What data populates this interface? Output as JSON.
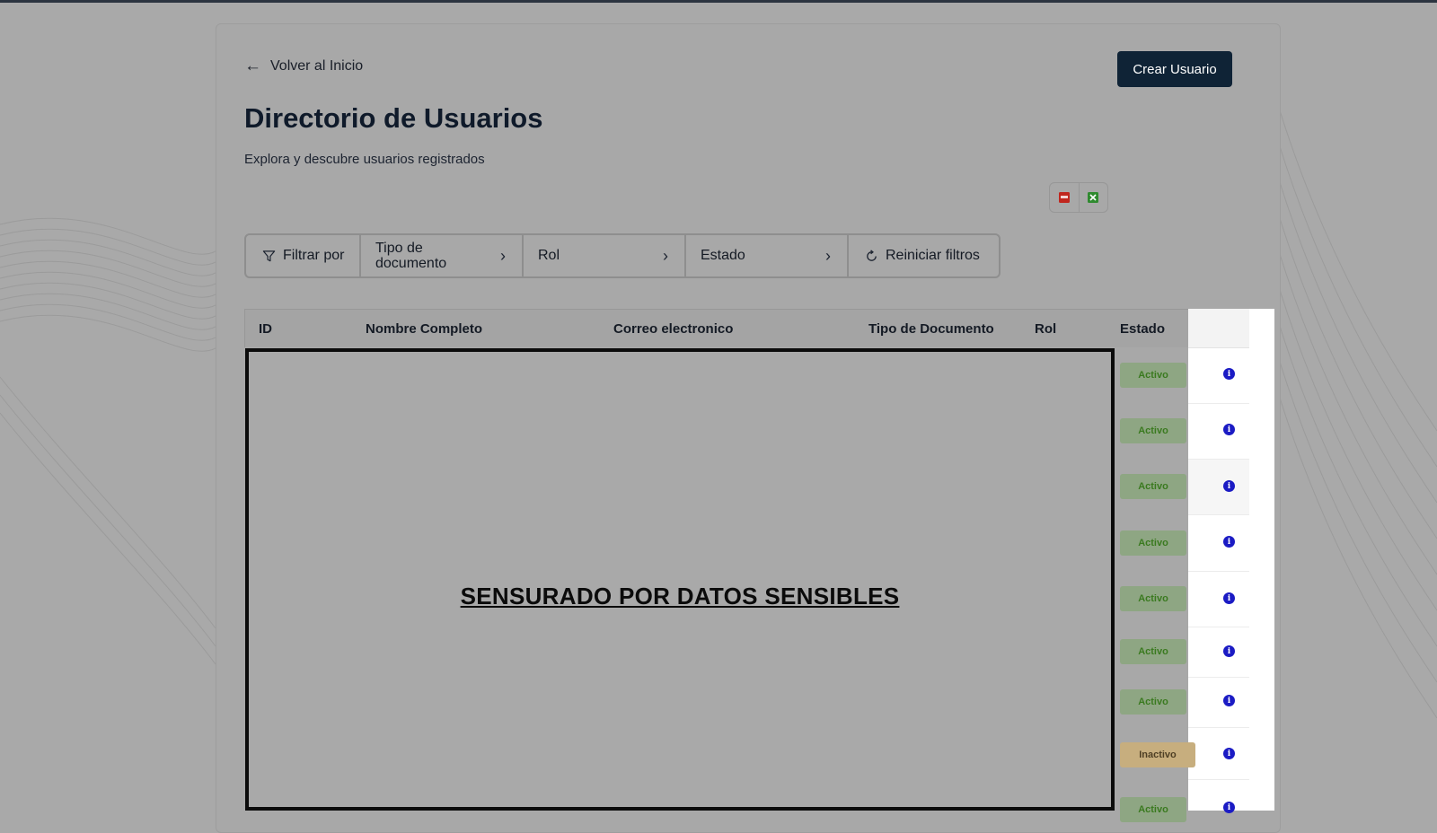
{
  "nav": {
    "back_label": "Volver al Inicio",
    "back_icon": "arrow-left-icon"
  },
  "header": {
    "title": "Directorio de Usuarios",
    "subtitle": "Explora y descubre usuarios registrados",
    "create_button": "Crear Usuario"
  },
  "export": {
    "pdf_icon": "pdf-icon",
    "excel_icon": "excel-icon",
    "pdf_color": "#c0261e",
    "excel_color": "#2f8a2f"
  },
  "filters": {
    "label": "Filtrar por",
    "doc_type": "Tipo de documento",
    "role": "Rol",
    "status": "Estado",
    "reset": "Reiniciar filtros"
  },
  "table": {
    "columns": [
      "ID",
      "Nombre Completo",
      "Correo electronico",
      "Tipo de Documento",
      "Rol",
      "Estado"
    ],
    "censor_text": "SENSURADO POR DATOS SENSIBLES",
    "statuses": [
      "Activo",
      "Activo",
      "Activo",
      "Activo",
      "Activo",
      "Activo",
      "Activo",
      "Inactivo",
      "Activo"
    ]
  },
  "colors": {
    "primary_button": "#0f2336",
    "active_badge_bg": "#8ea683",
    "active_badge_text": "#3a7a1f",
    "inactive_badge_bg": "#c7ae7e",
    "info_icon": "#1b1bc4"
  }
}
